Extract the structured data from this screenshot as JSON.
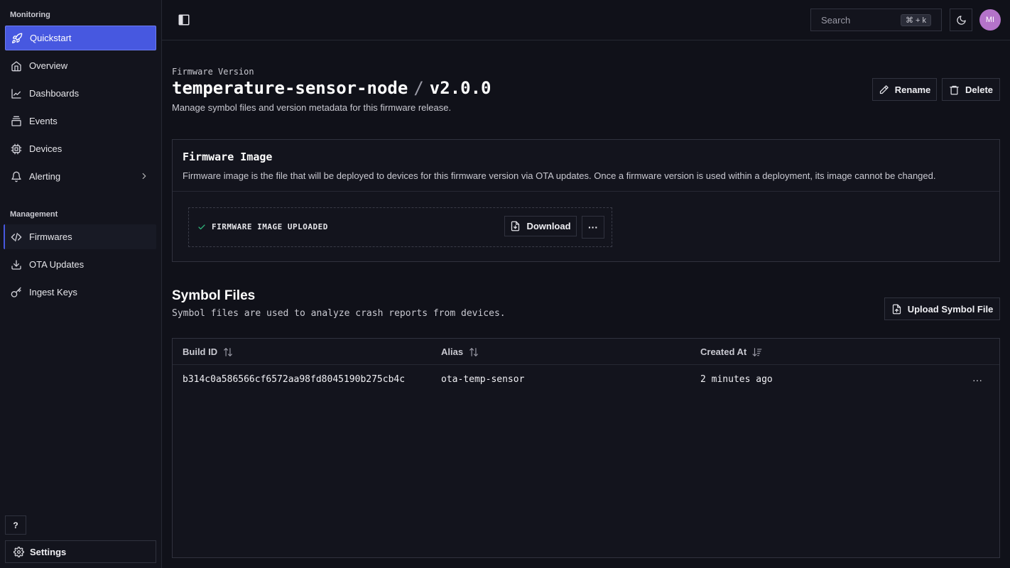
{
  "sidebar": {
    "monitoring_label": "Monitoring",
    "management_label": "Management",
    "items": [
      {
        "label": "Quickstart"
      },
      {
        "label": "Overview"
      },
      {
        "label": "Dashboards"
      },
      {
        "label": "Events"
      },
      {
        "label": "Devices"
      },
      {
        "label": "Alerting"
      },
      {
        "label": "Firmwares"
      },
      {
        "label": "OTA Updates"
      },
      {
        "label": "Ingest Keys"
      }
    ],
    "help_label": "?",
    "settings_label": "Settings"
  },
  "topbar": {
    "search_placeholder": "Search",
    "search_shortcut": "⌘ + k",
    "avatar_initials": "MI"
  },
  "header": {
    "eyebrow": "Firmware Version",
    "firmware_name": "temperature-sensor-node",
    "separator": "/",
    "version": "v2.0.0",
    "description": "Manage symbol files and version metadata for this firmware release.",
    "rename_label": "Rename",
    "delete_label": "Delete"
  },
  "firmware_image": {
    "title": "Firmware Image",
    "description": "Firmware image is the file that will be deployed to devices for this firmware version via OTA updates. Once a firmware version is used within a deployment, its image cannot be changed.",
    "status": "FIRMWARE IMAGE UPLOADED",
    "download_label": "Download",
    "more_label": "···"
  },
  "symbol_files": {
    "title": "Symbol Files",
    "description": "Symbol files are used to analyze crash reports from devices.",
    "upload_label": "Upload Symbol File",
    "columns": [
      "Build ID",
      "Alias",
      "Created At"
    ],
    "rows": [
      {
        "build_id": "b314c0a586566cf6572aa98fd8045190b275cb4c",
        "alias": "ota-temp-sensor",
        "created_at": "2 minutes ago",
        "menu": "···"
      }
    ]
  },
  "colors": {
    "accent": "#4758e0",
    "background": "#101119",
    "success": "#2fb37a",
    "avatar": "#b473c9"
  }
}
